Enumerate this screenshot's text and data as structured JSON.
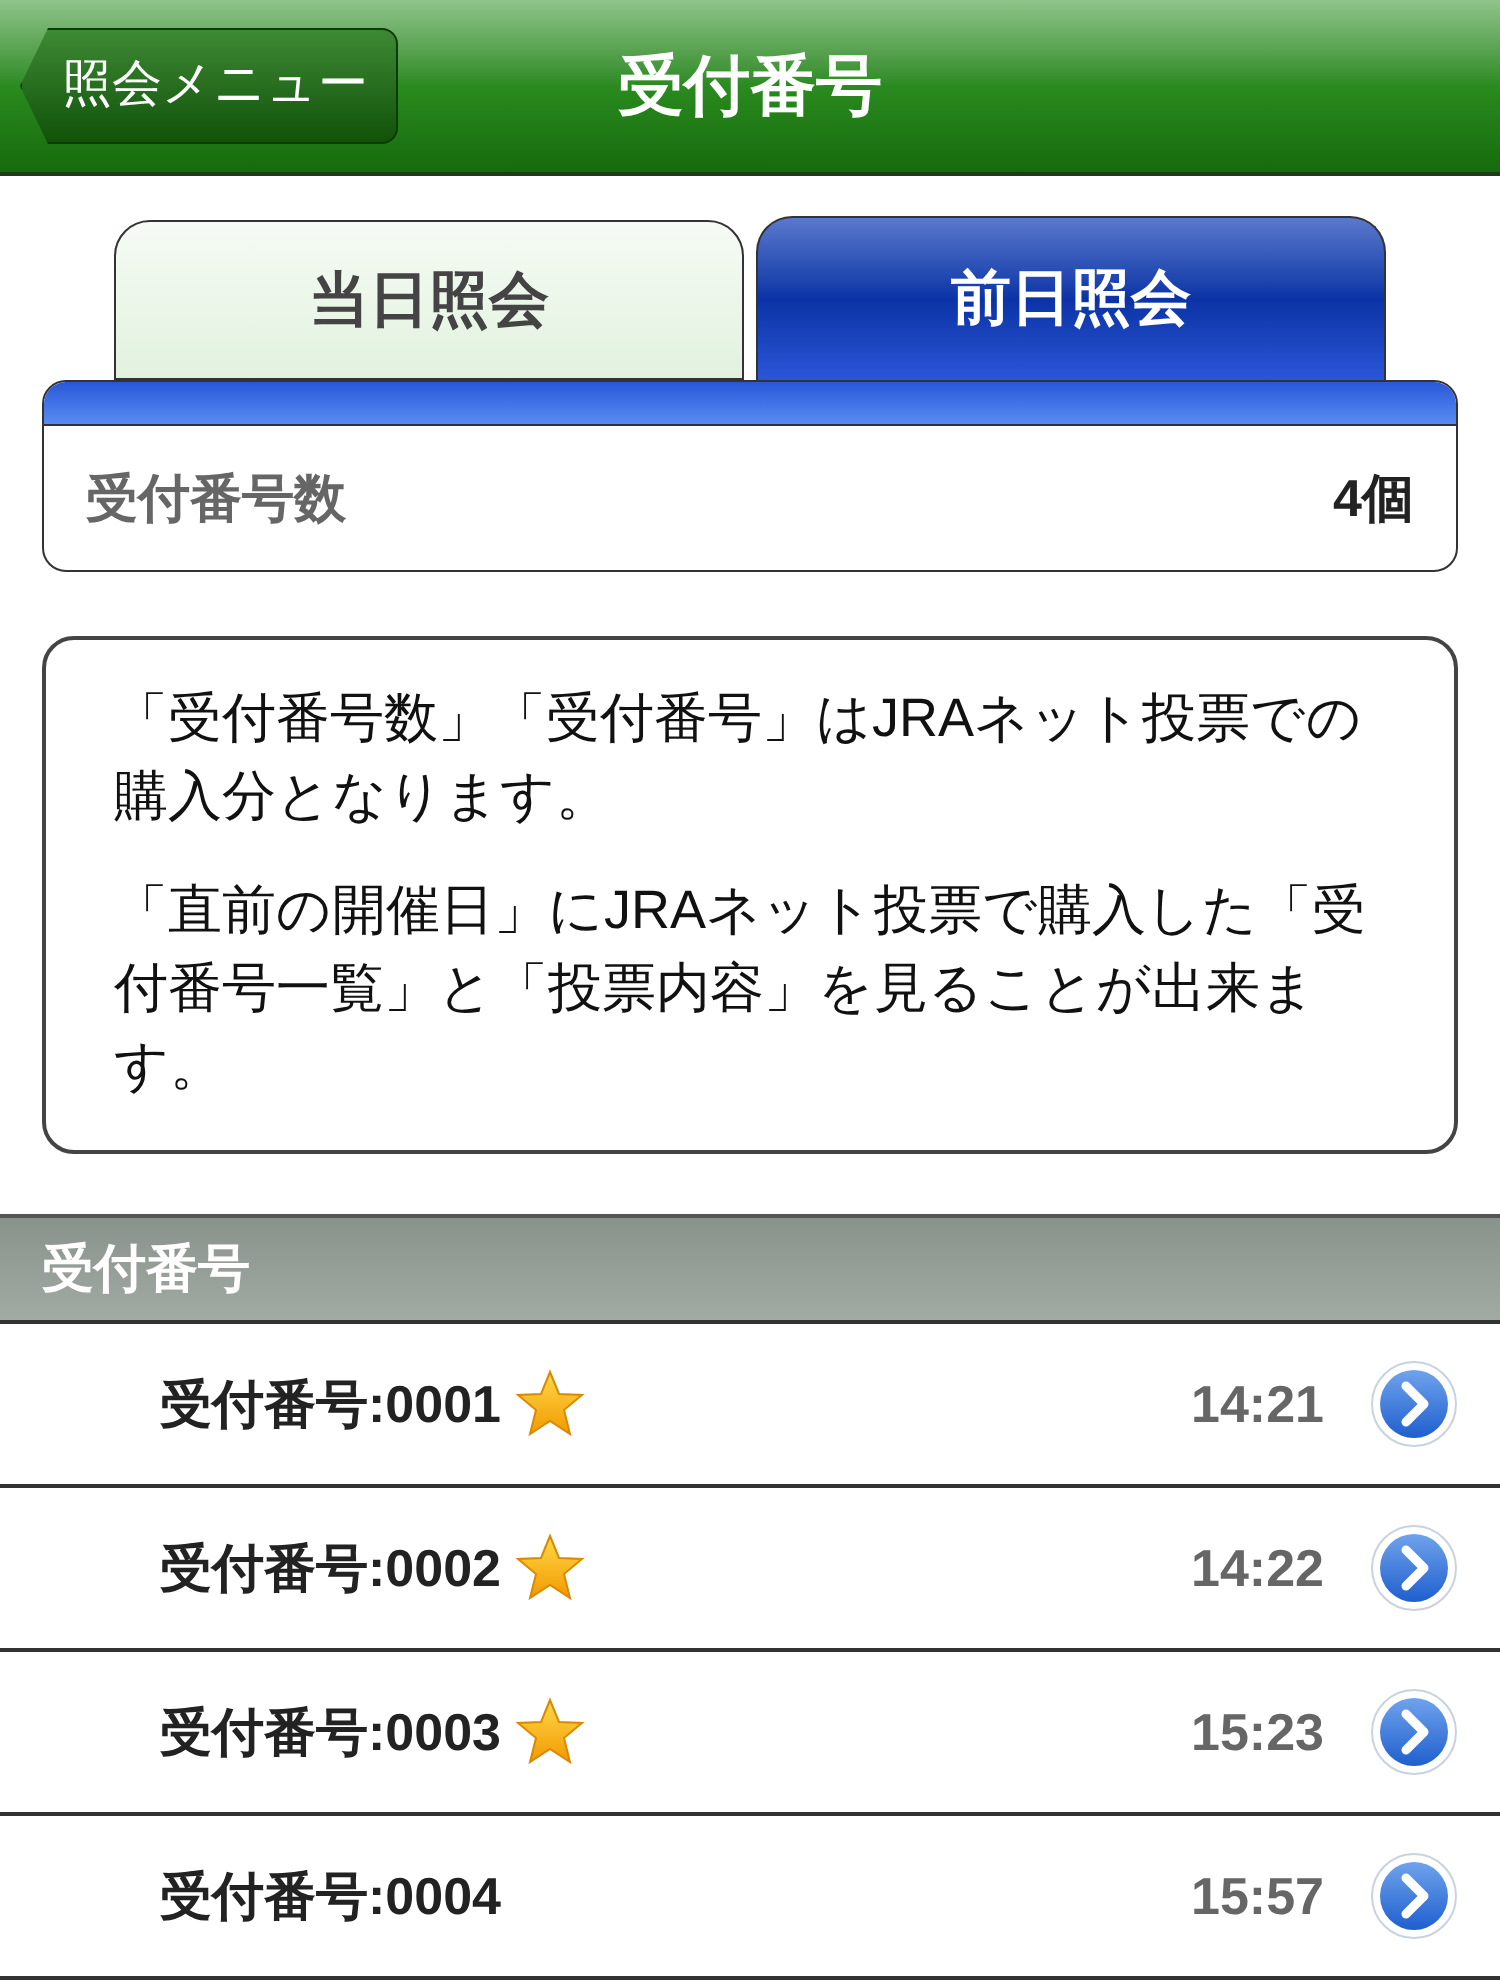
{
  "nav_bar": {
    "back_button": "照会メニュー",
    "title": "受付番号"
  },
  "tabs": [
    {
      "label": "当日照会",
      "selected": false
    },
    {
      "label": "前日照会",
      "selected": true
    }
  ],
  "summary": {
    "label": "受付番号数",
    "value": "4個"
  },
  "notice": [
    "「受付番号数」「受付番号」はJRAネット投票での購入分となります。",
    "「直前の開催日」にJRAネット投票で購入した「受付番号一覧」と「投票内容」を見ることが出来ます。"
  ],
  "section": {
    "title": "受付番号"
  },
  "rows": [
    {
      "label": "受付番号:0001",
      "starred": true,
      "time": "14:21"
    },
    {
      "label": "受付番号:0002",
      "starred": true,
      "time": "14:22"
    },
    {
      "label": "受付番号:0003",
      "starred": true,
      "time": "15:23"
    },
    {
      "label": "受付番号:0004",
      "starred": false,
      "time": "15:57"
    }
  ]
}
